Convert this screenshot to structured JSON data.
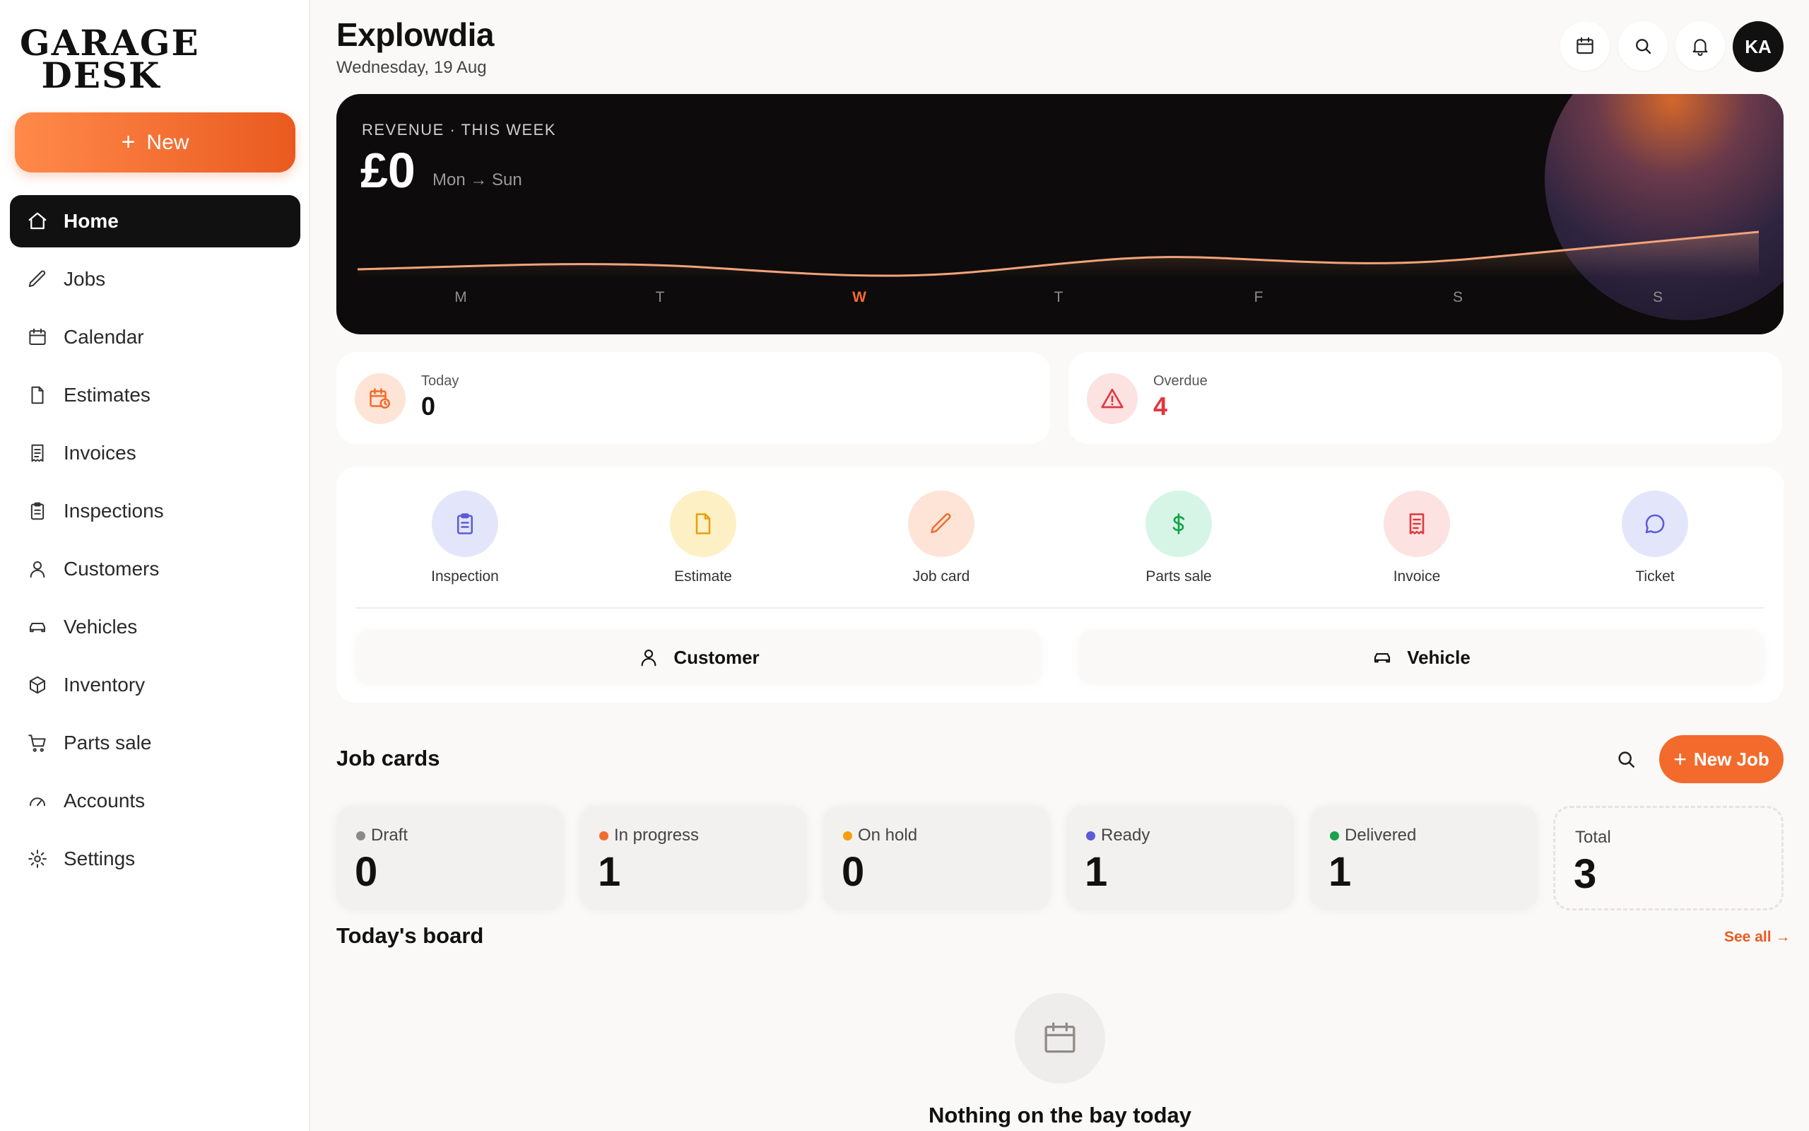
{
  "brand": {
    "line1": "GARAGE",
    "line2": "DESK"
  },
  "sidebar": {
    "new_label": "New",
    "items": [
      {
        "label": "Home",
        "icon": "home-icon",
        "active": true
      },
      {
        "label": "Jobs",
        "icon": "pen-icon"
      },
      {
        "label": "Calendar",
        "icon": "calendar-icon"
      },
      {
        "label": "Estimates",
        "icon": "document-icon"
      },
      {
        "label": "Invoices",
        "icon": "receipt-icon"
      },
      {
        "label": "Inspections",
        "icon": "clipboard-icon"
      },
      {
        "label": "Customers",
        "icon": "user-icon"
      },
      {
        "label": "Vehicles",
        "icon": "car-icon"
      },
      {
        "label": "Inventory",
        "icon": "box-icon"
      },
      {
        "label": "Parts sale",
        "icon": "cart-icon"
      },
      {
        "label": "Accounts",
        "icon": "gauge-icon"
      },
      {
        "label": "Settings",
        "icon": "gear-icon"
      }
    ]
  },
  "header": {
    "title": "Explowdia",
    "date": "Wednesday, 19 Aug",
    "avatar_initials": "KA"
  },
  "revenue": {
    "label": "REVENUE · THIS WEEK",
    "amount": "£0",
    "range": "Mon → Sun",
    "days": [
      "M",
      "T",
      "W",
      "T",
      "F",
      "S",
      "S"
    ],
    "current_day_index": 2
  },
  "stats": {
    "today": {
      "label": "Today",
      "value": "0"
    },
    "overdue": {
      "label": "Overdue",
      "value": "4"
    }
  },
  "quick_actions": {
    "items": [
      {
        "label": "Inspection",
        "icon": "clipboard-icon"
      },
      {
        "label": "Estimate",
        "icon": "document-icon"
      },
      {
        "label": "Job card",
        "icon": "pen-icon"
      },
      {
        "label": "Parts sale",
        "icon": "dollar-icon"
      },
      {
        "label": "Invoice",
        "icon": "receipt-icon"
      },
      {
        "label": "Ticket",
        "icon": "chat-icon"
      }
    ],
    "customer_label": "Customer",
    "vehicle_label": "Vehicle"
  },
  "job_cards": {
    "title": "Job cards",
    "new_job_label": "New Job",
    "statuses": [
      {
        "label": "Draft",
        "count": "0",
        "color": "#8a8a8a"
      },
      {
        "label": "In progress",
        "count": "1",
        "color": "#f26b2c"
      },
      {
        "label": "On hold",
        "count": "0",
        "color": "#f59e0b"
      },
      {
        "label": "Ready",
        "count": "1",
        "color": "#5b5bd6"
      },
      {
        "label": "Delivered",
        "count": "1",
        "color": "#16a34a"
      }
    ],
    "total": {
      "label": "Total",
      "count": "3"
    }
  },
  "board": {
    "title": "Today's board",
    "see_all": "See all →",
    "empty_text": "Nothing on the bay today"
  },
  "colors": {
    "accent": "#f26b2c",
    "danger": "#e0383e"
  }
}
